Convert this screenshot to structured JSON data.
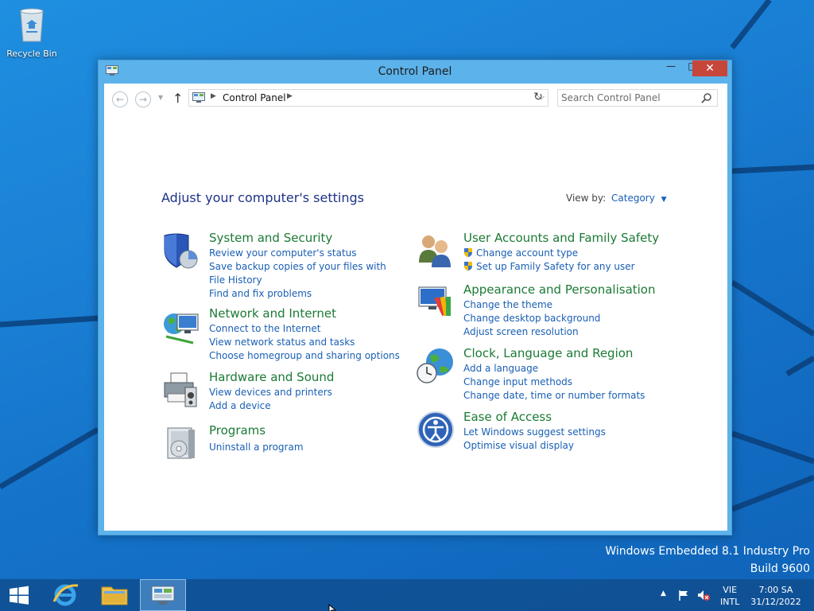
{
  "desktop": {
    "recycle_bin_label": "Recycle Bin",
    "watermark_line1": "Windows Embedded 8.1 Industry Pro",
    "watermark_line2": "Build 9600"
  },
  "window": {
    "title": "Control Panel",
    "minimize_label": "—",
    "maximize_label": "□",
    "close_label": "✕"
  },
  "addressbar": {
    "path": "Control Panel",
    "search_placeholder": "Search Control Panel"
  },
  "content": {
    "heading": "Adjust your computer's settings",
    "view_by_label": "View by:",
    "view_by_value": "Category"
  },
  "categories": [
    {
      "icon": "shield-icon",
      "title": "System and Security",
      "links": [
        "Review your computer's status",
        "Save backup copies of your files with File History",
        "Find and fix problems"
      ]
    },
    {
      "icon": "network-icon",
      "title": "Network and Internet",
      "links": [
        "Connect to the Internet",
        "View network status and tasks",
        "Choose homegroup and sharing options"
      ]
    },
    {
      "icon": "printer-icon",
      "title": "Hardware and Sound",
      "links": [
        "View devices and printers",
        "Add a device"
      ]
    },
    {
      "icon": "programs-icon",
      "title": "Programs",
      "links": [
        "Uninstall a program"
      ]
    },
    {
      "icon": "users-icon",
      "title": "User Accounts and Family Safety",
      "links": [
        "Change account type",
        "Set up Family Safety for any user"
      ]
    },
    {
      "icon": "appearance-icon",
      "title": "Appearance and Personalisation",
      "links": [
        "Change the theme",
        "Change desktop background",
        "Adjust screen resolution"
      ]
    },
    {
      "icon": "clock-globe-icon",
      "title": "Clock, Language and Region",
      "links": [
        "Add a language",
        "Change input methods",
        "Change date, time or number formats"
      ]
    },
    {
      "icon": "ease-of-access-icon",
      "title": "Ease of Access",
      "links": [
        "Let Windows suggest settings",
        "Optimise visual display"
      ]
    }
  ],
  "taskbar": {
    "language_line1": "VIE",
    "language_line2": "INTL",
    "time": "7:00 SA",
    "date": "31/12/2022"
  },
  "colors": {
    "category_title": "#1b7a35",
    "link": "#1a5fb4",
    "heading": "#1e3287",
    "close_button": "#c7463a",
    "window_frame": "#5cb2ea"
  }
}
